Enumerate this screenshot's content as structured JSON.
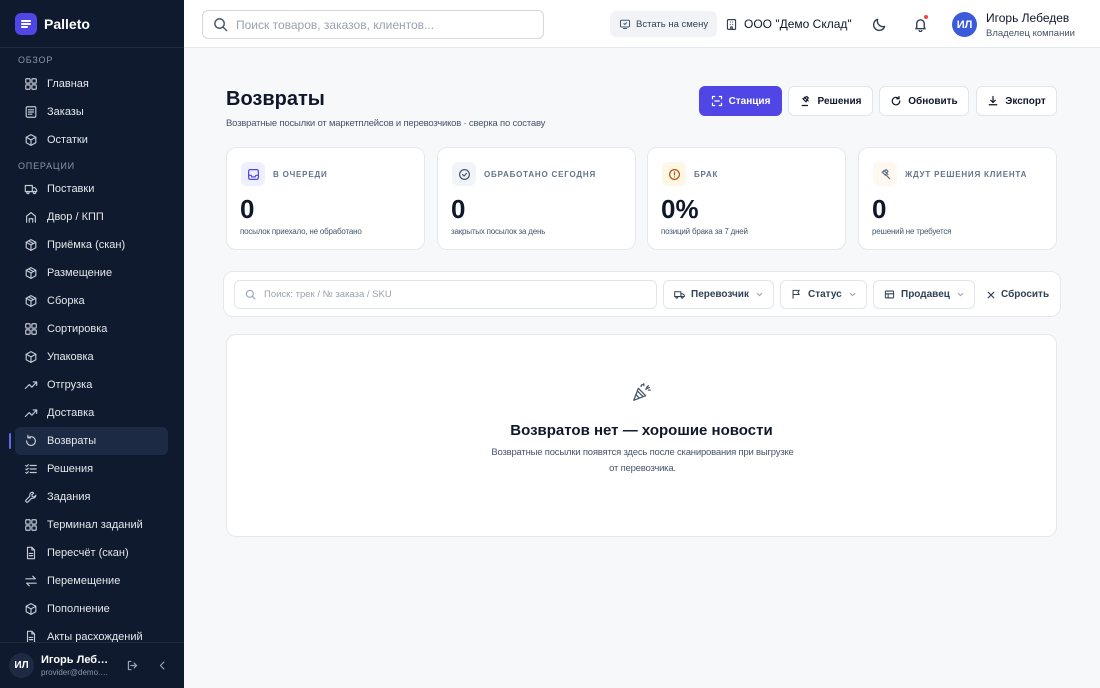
{
  "app": {
    "name": "Palleto"
  },
  "sidebar": {
    "sections": [
      {
        "label": "ОБЗОР",
        "items": [
          {
            "label": "Главная",
            "icon": "grid-icon"
          },
          {
            "label": "Заказы",
            "icon": "list-icon"
          },
          {
            "label": "Остатки",
            "icon": "box-icon"
          }
        ]
      },
      {
        "label": "ОПЕРАЦИИ",
        "items": [
          {
            "label": "Поставки",
            "icon": "truck-icon"
          },
          {
            "label": "Двор / КПП",
            "icon": "gate-icon"
          },
          {
            "label": "Приёмка (скан)",
            "icon": "package-icon"
          },
          {
            "label": "Размещение",
            "icon": "package-icon"
          },
          {
            "label": "Сборка",
            "icon": "package-icon"
          },
          {
            "label": "Сортировка",
            "icon": "grid-icon"
          },
          {
            "label": "Упаковка",
            "icon": "box-icon"
          },
          {
            "label": "Отгрузка",
            "icon": "trend-icon"
          },
          {
            "label": "Доставка",
            "icon": "trend-icon"
          },
          {
            "label": "Возвраты",
            "icon": "return-icon",
            "active": true
          },
          {
            "label": "Решения",
            "icon": "checklist-icon"
          },
          {
            "label": "Задания",
            "icon": "wrench-icon"
          },
          {
            "label": "Терминал заданий",
            "icon": "grid-icon"
          },
          {
            "label": "Пересчёт (скан)",
            "icon": "document-icon"
          },
          {
            "label": "Перемещение",
            "icon": "swap-icon"
          },
          {
            "label": "Пополнение",
            "icon": "box-icon"
          },
          {
            "label": "Акты расхождений",
            "icon": "document-icon"
          }
        ]
      }
    ],
    "user": {
      "initials": "ИЛ",
      "name": "Игорь Лебедев",
      "email": "provider@demo.palleto.ru"
    }
  },
  "topbar": {
    "search_placeholder": "Поиск товаров, заказов, клиентов...",
    "shift_label": "Встать на смену",
    "company": "ООО \"Демо Склад\"",
    "user": {
      "initials": "ИЛ",
      "name": "Игорь Лебедев",
      "role": "Владелец компании"
    }
  },
  "page": {
    "title": "Возвраты",
    "subtitle": "Возвратные посылки от маркетплейсов и перевозчиков · сверка по составу",
    "actions": {
      "station": "Станция",
      "decisions": "Решения",
      "refresh": "Обновить",
      "export": "Экспорт"
    }
  },
  "stats": [
    {
      "label": "В ОЧЕРЕДИ",
      "value": "0",
      "note": "посылок приехало, не обработано",
      "icon": "inbox-icon",
      "color": "#4f46e5",
      "bg": "#eef0ff"
    },
    {
      "label": "ОБРАБОТАНО СЕГОДНЯ",
      "value": "0",
      "note": "закрытых посылок за день",
      "icon": "check-circle-icon",
      "color": "#475569",
      "bg": "#f1f5f9"
    },
    {
      "label": "БРАК",
      "value": "0%",
      "note": "позиций брака за 7 дней",
      "icon": "alert-circle-icon",
      "color": "#b45309",
      "bg": "#fff7e6"
    },
    {
      "label": "ЖДУТ РЕШЕНИЯ КЛИЕНТА",
      "value": "0",
      "note": "решений не требуется",
      "icon": "gavel-icon",
      "color": "#64748b",
      "bg": "#fff8ee"
    }
  ],
  "filters": {
    "search_placeholder": "Поиск: трек / № заказа / SKU",
    "carrier": "Перевозчик",
    "status": "Статус",
    "seller": "Продавец",
    "reset": "Сбросить"
  },
  "empty": {
    "title": "Возвратов нет — хорошие новости",
    "description": "Возвратные посылки появятся здесь после сканирования при выгрузке от перевозчика."
  }
}
